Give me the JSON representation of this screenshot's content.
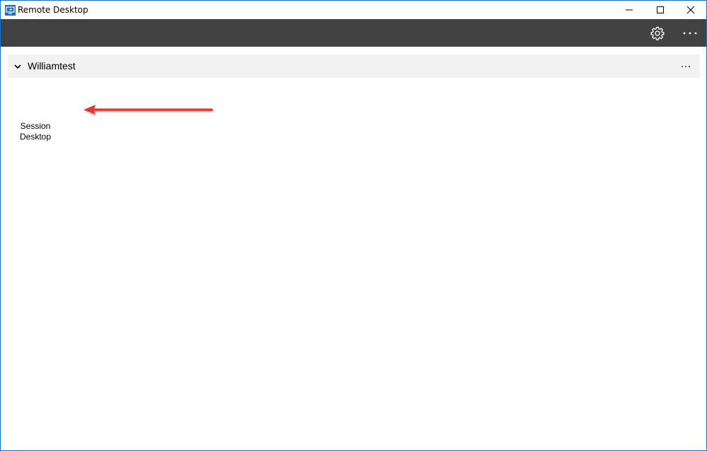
{
  "window": {
    "title": "Remote Desktop",
    "accent_color": "#1c6fc1"
  },
  "toolbar": {
    "background": "#424242",
    "settings_icon": "gear-icon",
    "more_icon": "more-horizontal-icon"
  },
  "group": {
    "name": "Williamtest",
    "expanded": true
  },
  "resources": [
    {
      "label_line1": "Session",
      "label_line2": "Desktop"
    }
  ],
  "annotation": {
    "arrow_color": "#e53935"
  }
}
